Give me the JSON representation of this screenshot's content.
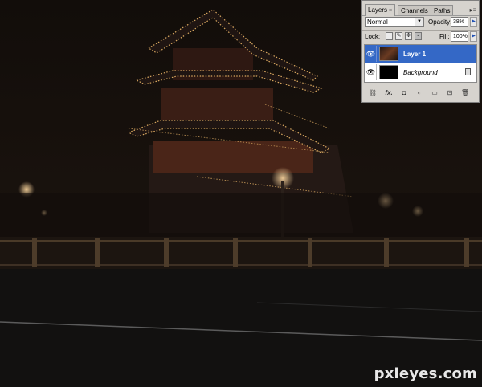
{
  "panel": {
    "tabs": [
      {
        "label": "Layers"
      },
      {
        "label": "Channels"
      },
      {
        "label": "Paths"
      }
    ],
    "tab_close_glyph": "×",
    "blend_mode": "Normal",
    "opacity_label": "Opacity:",
    "opacity_value": "38%",
    "lock_label": "Lock:",
    "fill_label": "Fill:",
    "fill_value": "100%",
    "layers": [
      {
        "name": "Layer 1",
        "selected": true,
        "visible": true
      },
      {
        "name": "Background",
        "selected": false,
        "visible": true,
        "locked": true
      }
    ],
    "bottom_icons": [
      "link-layers-icon",
      "fx-icon",
      "add-mask-icon",
      "adjustment-layer-icon",
      "new-group-icon",
      "new-layer-icon",
      "delete-layer-icon"
    ],
    "bottom_glyphs": {
      "link": "⛓",
      "fx": "fx.",
      "mask": "◘",
      "adjust": "◐",
      "group": "▭",
      "new": "⊡",
      "delete": "🗑"
    }
  },
  "watermark": "pxleyes.com",
  "colors": {
    "selection": "#3468c6",
    "panel_bg": "#d6d3ce",
    "scene_bg": "#0d0a08"
  }
}
